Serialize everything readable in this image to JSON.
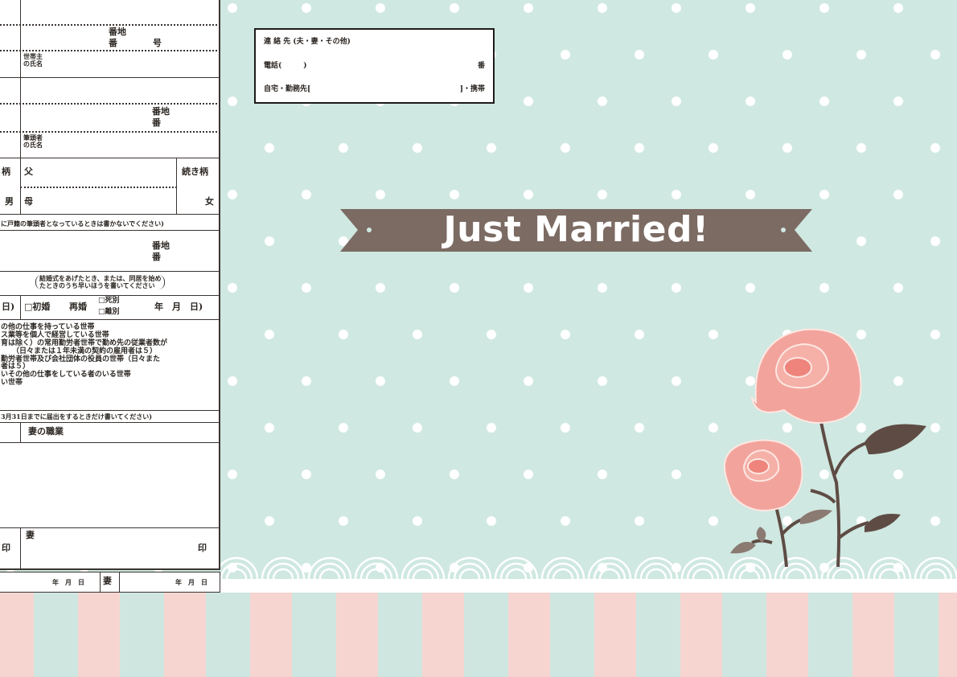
{
  "colors": {
    "mint": "#cfe8e1",
    "pink_stripe": "#f6d5d1",
    "teal_stripe": "#cfe6e0",
    "banner": "#7c6b63",
    "rose": "#f2a49c",
    "leaf": "#5e4c44"
  },
  "form": {
    "address_banchi": "番地",
    "address_ban_go": "番　　　　号",
    "householder_name": "世帯主\nの氏名",
    "honseki_banchi": "番地",
    "honseki_ban": "番",
    "head_name": "筆頭者\nの氏名",
    "relation_left": "柄",
    "father": "父",
    "relation_label": "続き柄",
    "male": "男",
    "mother": "母",
    "female": "女",
    "note_head": "に戸籍の筆頭者となっているときは書かないでください)",
    "new_banchi": "番地",
    "new_ban": "番",
    "cohabit_note_1": "結婚式をあげたとき、または、同居を始め",
    "cohabit_note_2": "たときのうち早いほうを書いてください",
    "day_close": "日)",
    "first_marriage": "□初婚",
    "remarriage": "再婚",
    "death": "□死別",
    "divorce": "□離別",
    "ymd": "年　月　日)",
    "occupations": [
      "の他の仕事を持っている世帯",
      "ス業等を個人で経営している世帯",
      "育は除く）の常用勤労者世帯で勤め先の従業者数が",
      "（日々または１年未満の契約の雇用者は５）",
      "勤労者世帯及び会社団体の役員の世帯（日々また",
      "者は５）",
      "いその他の仕事をしている者のいる世帯",
      "い世帯"
    ],
    "census_note": "3月31日までに届出をするときだけ書いてください)",
    "wife_occupation": "妻の職業",
    "seal_left": "印",
    "wife": "妻",
    "seal_right": "印",
    "date_left": "年　月　日",
    "date_wife": "妻",
    "date_right": "年　月　日"
  },
  "contact": {
    "title": "連 絡 先 (夫・妻・その他)",
    "phone": "電話(　　　)",
    "ban": "番",
    "work": "自宅・勤務先[",
    "mobile": "]・携帯"
  },
  "banner": {
    "title": "Just Married!"
  }
}
